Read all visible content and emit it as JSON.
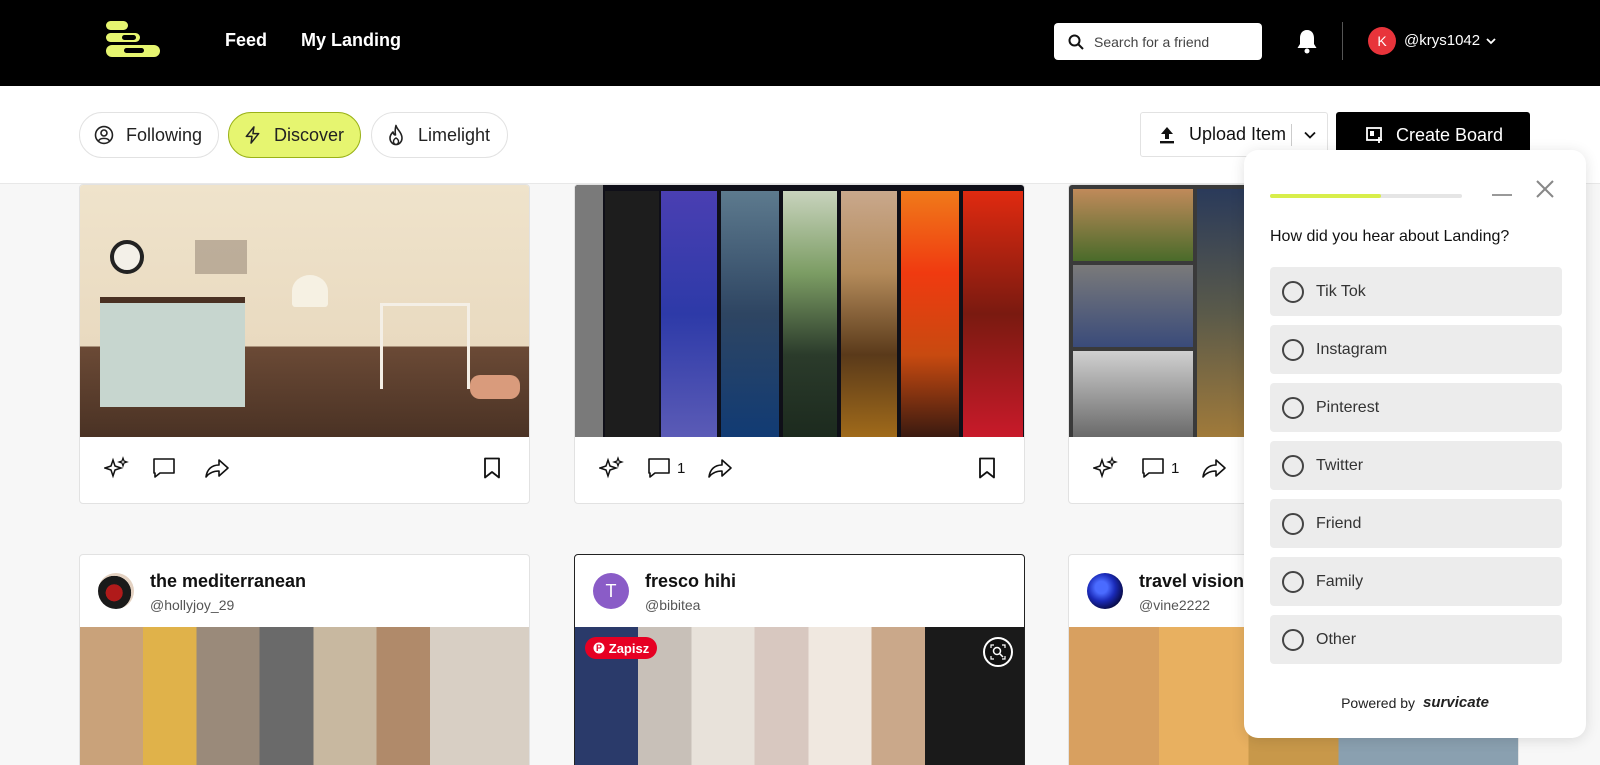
{
  "header": {
    "nav": [
      {
        "label": "Feed"
      },
      {
        "label": "My Landing"
      }
    ],
    "search_placeholder": "Search for a friend",
    "avatar_initial": "K",
    "username": "@krys1042"
  },
  "toolbar": {
    "filters": [
      {
        "label": "Following"
      },
      {
        "label": "Discover"
      },
      {
        "label": "Limelight"
      }
    ],
    "active_filter": "Discover",
    "upload_label": "Upload Item",
    "create_label": "Create Board"
  },
  "boards_top": [
    {
      "comment_count": ""
    },
    {
      "comment_count": "1"
    },
    {
      "comment_count": "1"
    }
  ],
  "boards_bottom": [
    {
      "title": "the mediterranean",
      "handle": "@hollyjoy_29",
      "avatar": ""
    },
    {
      "title": "fresco hihi",
      "handle": "@bibitea",
      "avatar": "T",
      "save_badge": "Zapisz"
    },
    {
      "title": "travel vision",
      "handle": "@vine2222",
      "avatar": ""
    }
  ],
  "survey": {
    "question": "How did you hear about Landing?",
    "progress": 0.58,
    "options": [
      {
        "label": "Tik Tok"
      },
      {
        "label": "Instagram"
      },
      {
        "label": "Pinterest"
      },
      {
        "label": "Twitter"
      },
      {
        "label": "Friend"
      },
      {
        "label": "Family"
      },
      {
        "label": "Other"
      }
    ],
    "powered_by": "Powered by",
    "brand": "survicate"
  },
  "colors": {
    "accent": "#e6f570",
    "accent_border": "#9ab218",
    "topbar": "#000000",
    "avatar_red": "#e8343b",
    "avatar_purple": "#8a5cc7"
  }
}
